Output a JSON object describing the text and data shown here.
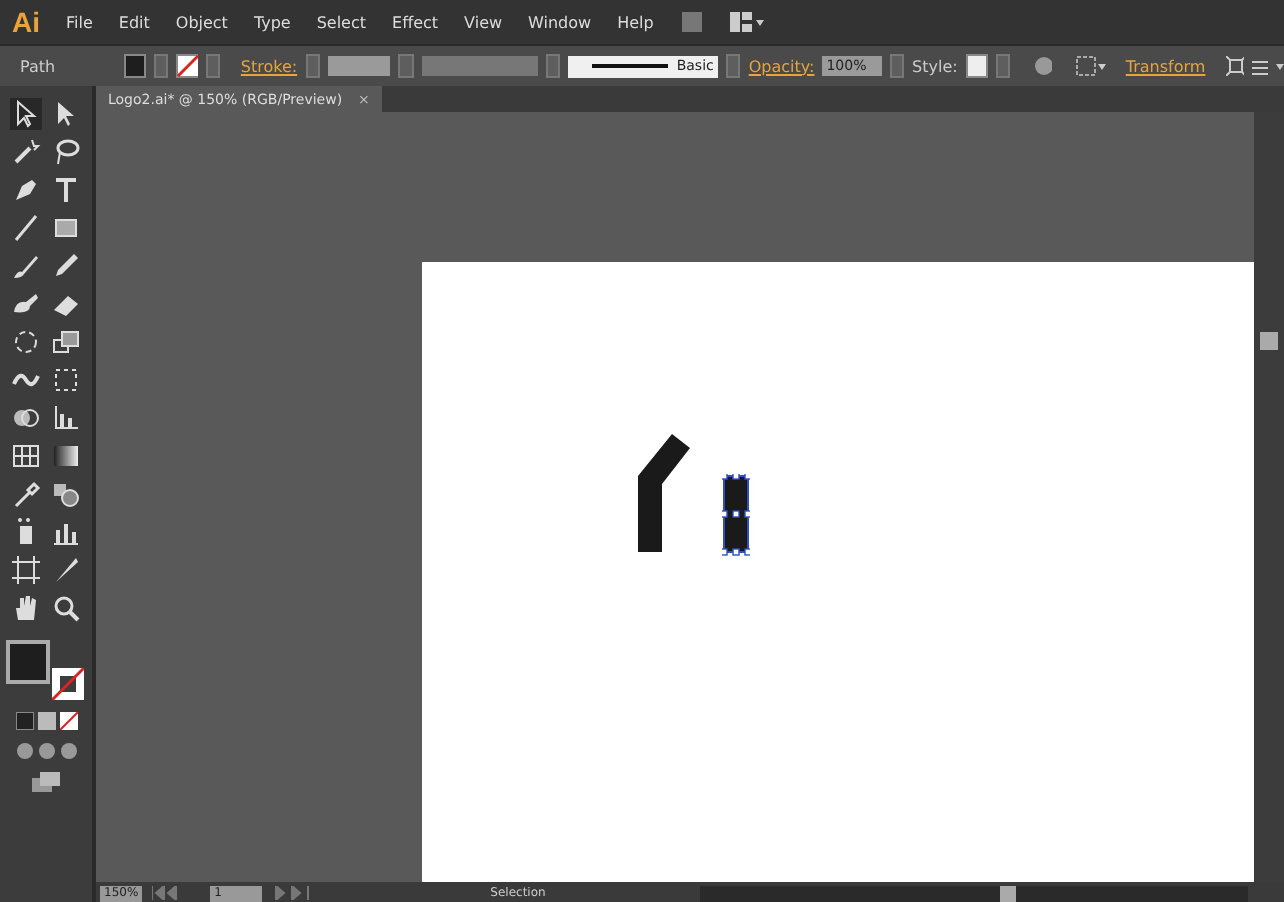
{
  "app_logo": "Ai",
  "menu": [
    "File",
    "Edit",
    "Object",
    "Type",
    "Select",
    "Effect",
    "View",
    "Window",
    "Help"
  ],
  "control_bar": {
    "object_type": "Path",
    "stroke_label": "Stroke:",
    "stroke_style": "Basic",
    "opacity_label": "Opacity:",
    "opacity_value": "100%",
    "style_label": "Style:",
    "transform_label": "Transform"
  },
  "document_tab": {
    "title": "Logo2.ai* @ 150% (RGB/Preview)",
    "close": "×"
  },
  "tools": [
    {
      "kind": "selection",
      "selected": true
    },
    {
      "kind": "direct",
      "selected": false
    },
    {
      "kind": "wand",
      "selected": false
    },
    {
      "kind": "lasso",
      "selected": false
    },
    {
      "kind": "pen",
      "selected": false
    },
    {
      "kind": "type",
      "selected": false
    },
    {
      "kind": "line",
      "selected": false
    },
    {
      "kind": "rect",
      "selected": false
    },
    {
      "kind": "brush",
      "selected": false
    },
    {
      "kind": "pencil",
      "selected": false
    },
    {
      "kind": "blob",
      "selected": false
    },
    {
      "kind": "eraser",
      "selected": false
    },
    {
      "kind": "rotate",
      "selected": false
    },
    {
      "kind": "scale",
      "selected": false
    },
    {
      "kind": "warp",
      "selected": false
    },
    {
      "kind": "free",
      "selected": false
    },
    {
      "kind": "shape",
      "selected": false
    },
    {
      "kind": "graph",
      "selected": false
    },
    {
      "kind": "mesh",
      "selected": false
    },
    {
      "kind": "gradient",
      "selected": false
    },
    {
      "kind": "eyedropper",
      "selected": false
    },
    {
      "kind": "blend",
      "selected": false
    },
    {
      "kind": "symbol",
      "selected": false
    },
    {
      "kind": "column",
      "selected": false
    },
    {
      "kind": "artboard",
      "selected": false
    },
    {
      "kind": "knife",
      "selected": false
    },
    {
      "kind": "hand",
      "selected": false
    },
    {
      "kind": "zoom",
      "selected": false
    }
  ],
  "artwork": [
    {
      "kind": "bent-bar",
      "selected": false
    },
    {
      "kind": "bar",
      "selected": true
    }
  ],
  "status_bar": {
    "zoom": "150%",
    "page": "1",
    "status": "Selection"
  }
}
